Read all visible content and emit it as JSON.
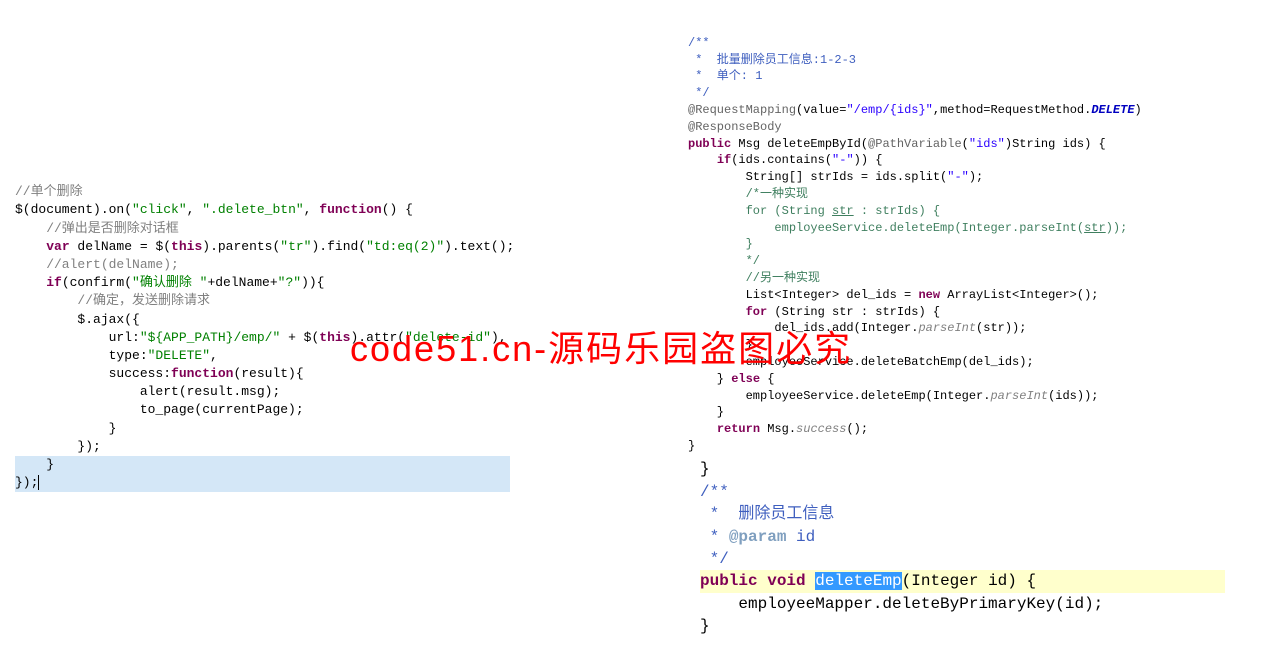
{
  "watermark": "code51.cn-源码乐园盗图必究",
  "left_block": {
    "c1": "//单个删除",
    "l2_a": "$(document).on(",
    "l2_s1": "\"click\"",
    "l2_b": ", ",
    "l2_s2": "\".delete_btn\"",
    "l2_c": ", ",
    "l2_kw": "function",
    "l2_d": "() {",
    "c2": "    //弹出是否删除对话框",
    "l4_a": "    ",
    "l4_kw": "var",
    "l4_b": " delName = $(",
    "l4_kw2": "this",
    "l4_c": ").parents(",
    "l4_s1": "\"tr\"",
    "l4_d": ").find(",
    "l4_s2": "\"td:eq(2)\"",
    "l4_e": ").text();",
    "c3": "    //alert(delName);",
    "l6_a": "    ",
    "l6_kw": "if",
    "l6_b": "(confirm(",
    "l6_s1": "\"确认删除 \"",
    "l6_c": "+delName+",
    "l6_s2": "\"?\"",
    "l6_d": ")){",
    "c4": "        //确定，发送删除请求",
    "l8": "        $.ajax({",
    "l9_a": "            url:",
    "l9_s1": "\"${APP_PATH}/emp/\"",
    "l9_b": " + $(",
    "l9_kw": "this",
    "l9_c": ").attr(",
    "l9_s2": "\"delete-id\"",
    "l9_d": "),",
    "l10_a": "            type:",
    "l10_s": "\"DELETE\"",
    "l10_b": ",",
    "l11_a": "            success:",
    "l11_kw": "function",
    "l11_b": "(result){",
    "l12": "                alert(result.msg);",
    "l13": "                to_page(currentPage);",
    "l14": "            }",
    "l15": "        });",
    "l16": "    }",
    "l17": "});"
  },
  "right_top": {
    "jd1": "/**",
    "jd2": " *  批量删除员工信息:1-2-3",
    "jd3": " *  单个: 1",
    "jd4": " */",
    "an1_a": "@RequestMapping",
    "an1_b": "(value=",
    "an1_s1": "\"/emp/{ids}\"",
    "an1_c": ",method=RequestMethod.",
    "an1_d": "DELETE",
    "an1_e": ")",
    "an2": "@ResponseBody",
    "m1_kw1": "public",
    "m1_a": " Msg deleteEmpById(",
    "m1_an": "@PathVariable",
    "m1_b": "(",
    "m1_s": "\"ids\"",
    "m1_c": ")String ids) {",
    "m2_a": "    ",
    "m2_kw": "if",
    "m2_b": "(ids.contains(",
    "m2_s": "\"-\"",
    "m2_c": ")) {",
    "m3_a": "        String[] strIds = ids.split(",
    "m3_s": "\"-\"",
    "m3_b": ");",
    "c5": "        /*一种实现",
    "c6a": "        for (String ",
    "c6u": "str",
    "c6b": " : strIds) {",
    "c7a": "            employeeService.deleteEmp(Integer.parseInt(",
    "c7u": "str",
    "c7b": "));",
    "c8": "        }",
    "c9": "        */",
    "c10": "        //另一种实现",
    "m4_a": "        List<Integer> del_ids = ",
    "m4_kw": "new",
    "m4_b": " ArrayList<Integer>();",
    "m5_a": "        ",
    "m5_kw": "for",
    "m5_b": " (String str : strIds) {",
    "m6_a": "            del_ids.add(Integer.",
    "m6_i": "parseInt",
    "m6_b": "(str));",
    "m7": "        }",
    "m8": "        employeeService.deleteBatchEmp(del_ids);",
    "m9_a": "    } ",
    "m9_kw": "else",
    "m9_b": " {",
    "m10_a": "        employeeService.deleteEmp(Integer.",
    "m10_i": "parseInt",
    "m10_b": "(ids));",
    "m11": "    }",
    "m12_a": "    ",
    "m12_kw": "return",
    "m12_b": " Msg.",
    "m12_i": "success",
    "m12_c": "();",
    "m13": "}"
  },
  "right_bottom": {
    "l0": "}",
    "jd1": "/**",
    "jd2": " *  删除员工信息",
    "jd3_a": " * ",
    "jd3_tag": "@param",
    "jd3_b": " id",
    "jd4": " */",
    "m1_kw1": "public",
    "m1_sp": " ",
    "m1_kw2": "void",
    "m1_sp2": " ",
    "m1_sel": "deleteEmp",
    "m1_b": "(Integer id) {",
    "m2": "    employeeMapper.deleteByPrimaryKey(id);",
    "m3": "}"
  }
}
